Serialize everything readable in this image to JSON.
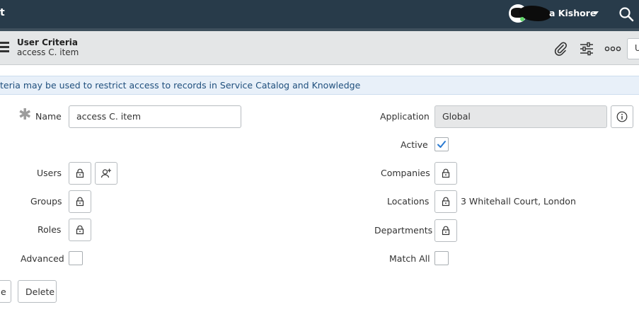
{
  "header": {
    "brand": "t",
    "user_name": "a Kishore"
  },
  "form": {
    "title": "User Criteria",
    "subtitle": "access C. item",
    "update_label": "U"
  },
  "banner": {
    "text": "teria may be used to restrict access to records in Service Catalog and Knowledge"
  },
  "fields": {
    "name_label": "Name",
    "name_value": "access C. item",
    "application_label": "Application",
    "application_value": "Global",
    "active_label": "Active",
    "active_checked": true,
    "users_label": "Users",
    "companies_label": "Companies",
    "groups_label": "Groups",
    "locations_label": "Locations",
    "locations_value": "3 Whitehall Court, London",
    "roles_label": "Roles",
    "departments_label": "Departments",
    "advanced_label": "Advanced",
    "advanced_checked": false,
    "match_all_label": "Match All",
    "match_all_checked": false
  },
  "actions": {
    "update_label": "e",
    "delete_label": "Delete"
  },
  "colors": {
    "header_bg": "#283b4a",
    "banner_bg": "#e8f0f9",
    "banner_text": "#1f4f7d",
    "check_color": "#2a7ad1"
  },
  "icons": [
    "search-icon",
    "paperclip-icon",
    "sliders-icon",
    "more-icon",
    "lock-icon",
    "add-user-icon",
    "info-icon",
    "checkmark-icon",
    "hamburger-icon"
  ]
}
